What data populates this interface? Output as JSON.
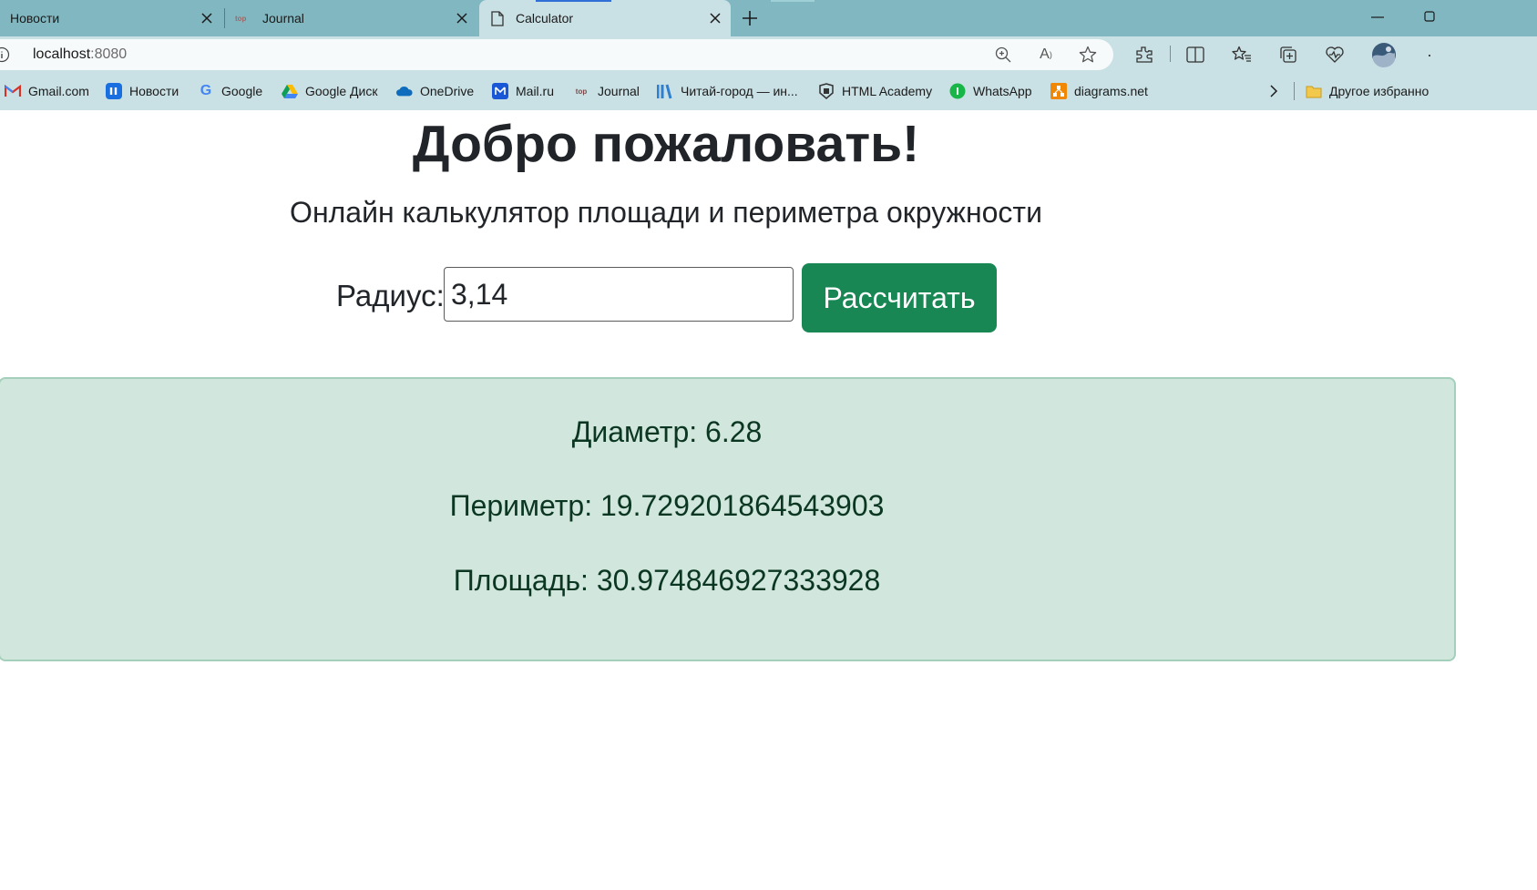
{
  "browser": {
    "tabs": [
      {
        "title": "Новости",
        "active": false
      },
      {
        "title": "Journal",
        "active": false
      },
      {
        "title": "Calculator",
        "active": true
      }
    ],
    "address": {
      "host": "localhost",
      "port": ":8080"
    },
    "bookmarks": [
      {
        "label": "Gmail.com",
        "icon": "gmail-icon"
      },
      {
        "label": "Новости",
        "icon": "news-icon"
      },
      {
        "label": "Google",
        "icon": "google-icon"
      },
      {
        "label": "Google Диск",
        "icon": "google-drive-icon"
      },
      {
        "label": "OneDrive",
        "icon": "onedrive-icon"
      },
      {
        "label": "Mail.ru",
        "icon": "mailru-icon"
      },
      {
        "label": "Journal",
        "icon": "journal-icon"
      },
      {
        "label": "Читай-город — ин...",
        "icon": "chitai-gorod-icon"
      },
      {
        "label": "HTML Academy",
        "icon": "html-academy-icon"
      },
      {
        "label": "WhatsApp",
        "icon": "whatsapp-icon"
      },
      {
        "label": "diagrams.net",
        "icon": "diagrams-icon"
      }
    ],
    "other_favorites": "Другое избранно",
    "colors": {
      "tabstrip": "#80b7c0",
      "toolbar": "#c9e0e4",
      "accent": "#2f6fd6"
    }
  },
  "page": {
    "heading": "Добро пожаловать!",
    "subtitle": "Онлайн калькулятор площади и периметра окружности",
    "form": {
      "radius_label": "Радиус:",
      "radius_value": "3,14",
      "button_label": "Рассчитать"
    },
    "results": {
      "diameter": "Диаметр: 6.28",
      "perimeter": "Периметр: 19.729201864543903",
      "area": "Площадь: 30.974846927333928"
    },
    "colors": {
      "button": "#198754",
      "result_bg": "#d1e7dd",
      "result_border": "#a3cfbb",
      "result_text": "#0a3622"
    }
  }
}
